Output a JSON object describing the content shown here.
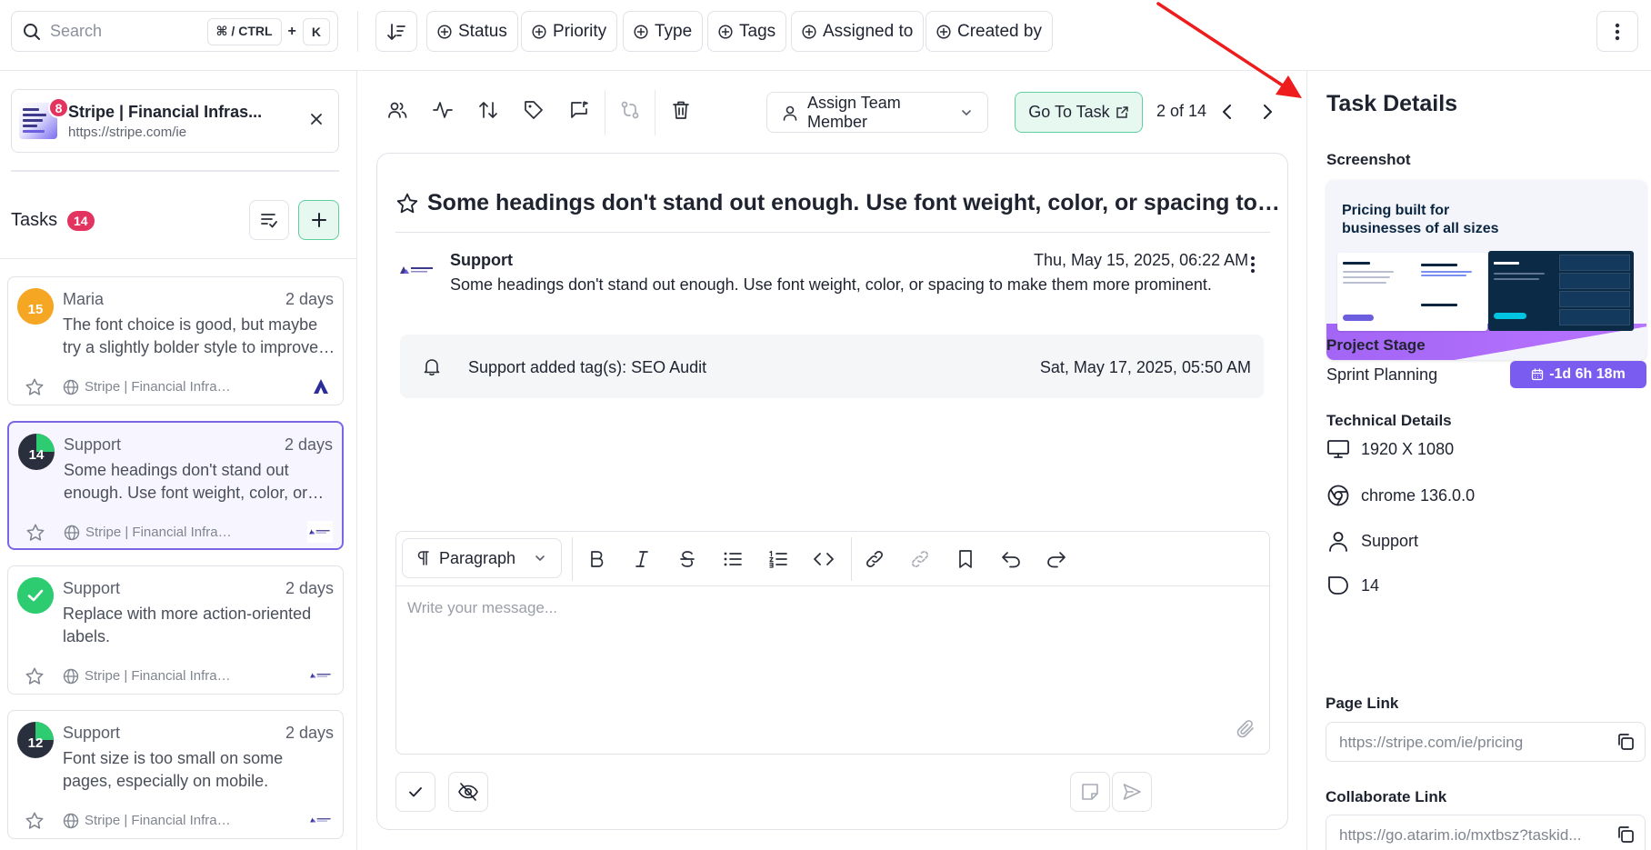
{
  "search": {
    "placeholder": "Search",
    "shortcut_keys": "⌘ / CTRL",
    "shortcut_plus": "+",
    "shortcut_k": "K"
  },
  "filters": [
    {
      "label": "Status"
    },
    {
      "label": "Priority"
    },
    {
      "label": "Type"
    },
    {
      "label": "Tags"
    },
    {
      "label": "Assigned to"
    },
    {
      "label": "Created by"
    }
  ],
  "site": {
    "title": "Stripe | Financial Infras...",
    "url": "https://stripe.com/ie",
    "badge": "8"
  },
  "tasks_header": {
    "label": "Tasks",
    "count": "14"
  },
  "tasks": [
    {
      "number": "15",
      "author": "Maria",
      "age": "2 days",
      "text": "The font choice is good, but maybe try a slightly bolder style to improve…",
      "site": "Stripe | Financial Infra…",
      "ring_color": "#f5a623",
      "fill_color": "#f5a623",
      "progress": 0.75,
      "active": false
    },
    {
      "number": "14",
      "author": "Support",
      "age": "2 days",
      "text": "Some headings don't stand out enough. Use font weight, color, or…",
      "site": "Stripe | Financial Infra…",
      "ring_color": "#2ecc71",
      "fill_color": "#2a2f3d",
      "progress": 0.25,
      "active": true
    },
    {
      "number": "",
      "author": "Support",
      "age": "2 days",
      "text": "Replace with more action-oriented labels.",
      "site": "Stripe | Financial Infra…",
      "ring_color": "#2ecc71",
      "fill_color": "#2ecc71",
      "progress": 1.0,
      "active": false,
      "done": true
    },
    {
      "number": "12",
      "author": "Support",
      "age": "2 days",
      "text": "Font size is too small on some pages, especially on mobile.",
      "site": "Stripe | Financial Infra…",
      "ring_color": "#2ecc71",
      "fill_color": "#2a2f3d",
      "progress": 0.25,
      "active": false
    }
  ],
  "toolbar": {
    "assign_label": "Assign Team Member",
    "goto_label": "Go To Task",
    "pager": "2 of 14"
  },
  "conversation": {
    "title": "Some headings don't stand out enough. Use font weight, color, or spacing to…",
    "message": {
      "author": "Support",
      "date": "Thu, May 15, 2025, 06:22 AM",
      "body": "Some headings don't stand out enough. Use font weight, color, or spacing to make them more prominent."
    },
    "activity": {
      "text": "Support added tag(s): SEO Audit",
      "date": "Sat, May 17, 2025, 05:50 AM"
    }
  },
  "editor": {
    "block_type": "Paragraph",
    "placeholder": "Write your message..."
  },
  "details": {
    "title": "Task Details",
    "screenshot_label": "Screenshot",
    "screenshot_heading_1": "Pricing built for",
    "screenshot_heading_2": "businesses of all sizes",
    "project_stage_label": "Project Stage",
    "project_stage_value": "Sprint Planning",
    "stage_timer": "-1d 6h 18m",
    "technical_label": "Technical Details",
    "resolution": "1920 X 1080",
    "browser": "chrome 136.0.0",
    "user": "Support",
    "task_number": "14",
    "page_link_label": "Page Link",
    "page_link": "https://stripe.com/ie/pricing",
    "collab_link_label": "Collaborate Link",
    "collab_link": "https://go.atarim.io/mxtbsz?taskid..."
  },
  "colors": {
    "accent_green": "#5fcfa0",
    "accent_purple": "#7a5df0",
    "badge_red": "#e2345f",
    "active_border": "#7d66e6"
  }
}
